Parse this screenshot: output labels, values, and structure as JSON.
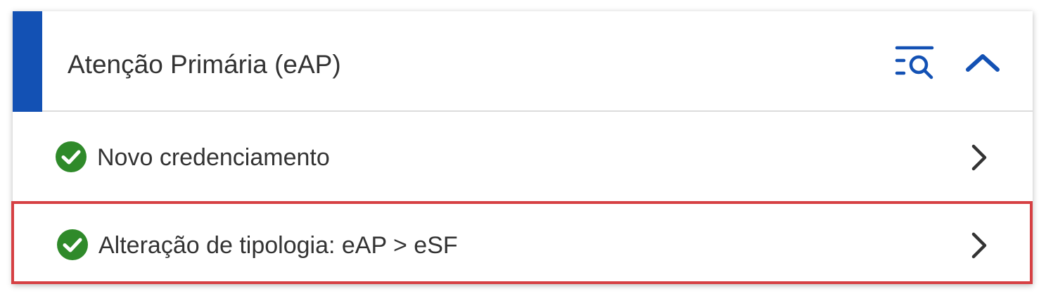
{
  "panel": {
    "title": "Atenção Primária (eAP)",
    "accent_color": "#1351b4",
    "filter_icon": "list-search-icon",
    "collapse_icon": "chevron-up-icon"
  },
  "items": [
    {
      "label": "Novo credenciamento",
      "status_icon": "check-circle-icon",
      "status_color": "#2f8a2a",
      "action_icon": "chevron-right-icon",
      "highlighted": false
    },
    {
      "label": "Alteração de tipologia: eAP > eSF",
      "status_icon": "check-circle-icon",
      "status_color": "#2f8a2a",
      "action_icon": "chevron-right-icon",
      "highlighted": true
    }
  ],
  "highlight_color": "#d64043"
}
